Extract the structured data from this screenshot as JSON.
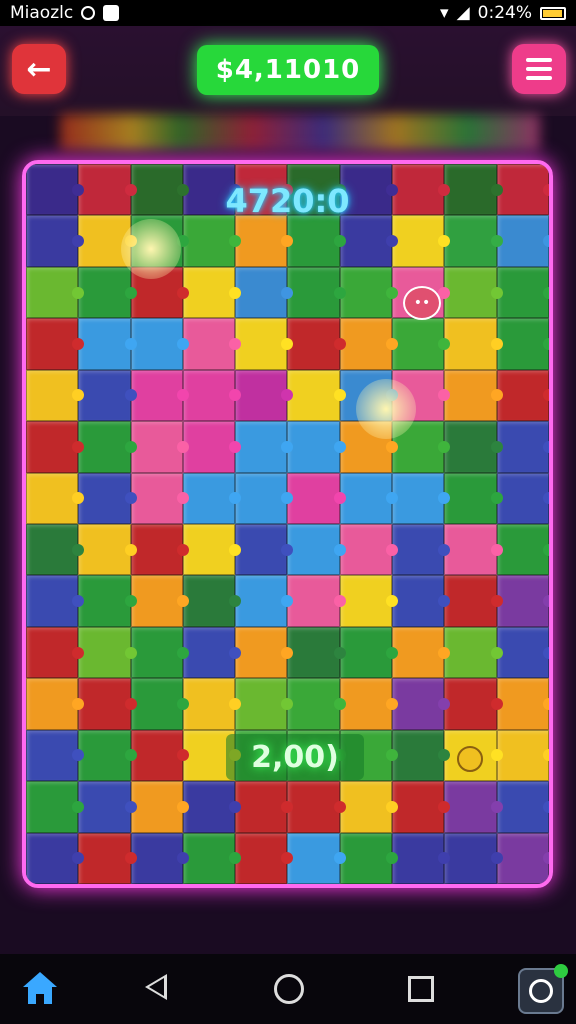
{
  "status_bar": {
    "app_name": "Miaozlc",
    "time": "0:24%"
  },
  "header": {
    "back_icon": "back-arrow-icon",
    "money": "$4,11010",
    "menu_icon": "hamburger-menu-icon"
  },
  "board": {
    "top_score": "4720:0",
    "bonus_score": "2,00)",
    "tile_colors": [
      "#3a2a8a",
      "#c0283a",
      "#2a6a2a",
      "#3a2a8a",
      "#c0283a",
      "#2a6a2a",
      "#3a2a8a",
      "#c0283a",
      "#2a6a2a",
      "#c0283a",
      "#3a3aa0",
      "#f0c020",
      "#2a9a3a",
      "#3aa838",
      "#f09a20",
      "#2a9a3a",
      "#3a3aa0",
      "#f0d020",
      "#30a040",
      "#3a8ad0",
      "#6ab830",
      "#2a9a3a",
      "#c0282a",
      "#f0d020",
      "#3a8ad0",
      "#2a9a3a",
      "#3aa838",
      "#e85a9a",
      "#6ab830",
      "#2a9a3a",
      "#c0282a",
      "#3a9ae0",
      "#3a9ae0",
      "#e85a9a",
      "#f0d020",
      "#c0282a",
      "#f09a20",
      "#3aa838",
      "#f0c020",
      "#2a9a3a",
      "#f0c020",
      "#3a4ab0",
      "#e040a0",
      "#e040a0",
      "#c030a0",
      "#f0d020",
      "#3a8ad0",
      "#e85a9a",
      "#f09a20",
      "#c0282a",
      "#c0282a",
      "#2a9a3a",
      "#e85a9a",
      "#e040a0",
      "#3a9ae0",
      "#3a9ae0",
      "#f09a20",
      "#3aa838",
      "#2a7a3a",
      "#3a4ab0",
      "#f0c020",
      "#3a4ab0",
      "#e85a9a",
      "#3a9ae0",
      "#3a9ae0",
      "#e040a0",
      "#3a9ae0",
      "#3a9ae0",
      "#2a9a3a",
      "#3a4ab0",
      "#2a7a3a",
      "#f0c020",
      "#c0282a",
      "#f0d020",
      "#3a4ab0",
      "#3a9ae0",
      "#e85a9a",
      "#3a4ab0",
      "#e85a9a",
      "#2a9a3a",
      "#3a4ab0",
      "#2a9a3a",
      "#f09a20",
      "#2a7a3a",
      "#3a9ae0",
      "#e85a9a",
      "#f0d020",
      "#3a4ab0",
      "#c0282a",
      "#7a3aa0",
      "#c0282a",
      "#6ab830",
      "#2a9a3a",
      "#3a4ab0",
      "#f09a20",
      "#2a7a3a",
      "#2a9a3a",
      "#f09a20",
      "#6ab830",
      "#3a4ab0",
      "#f09a20",
      "#c0282a",
      "#2a9a3a",
      "#f0c020",
      "#6ab830",
      "#3aa838",
      "#f09a20",
      "#7a3aa0",
      "#c0282a",
      "#f09a20",
      "#3a4ab0",
      "#2a9a3a",
      "#c0282a",
      "#f0d020",
      "#3aa838",
      "#3aa838",
      "#3aa838",
      "#2a7a3a",
      "#f0d020",
      "#f0c020",
      "#2a9a3a",
      "#3a4ab0",
      "#f09a20",
      "#3a3aa0",
      "#c0282a",
      "#c0282a",
      "#f0c020",
      "#c0282a",
      "#7a3aa0",
      "#3a4ab0",
      "#3a3aa0",
      "#c0282a",
      "#3a3aa0",
      "#2a9a3a",
      "#c0282a",
      "#3a9ae0",
      "#2a9a3a",
      "#3a3aa0",
      "#3a3aa0",
      "#7a3aa0"
    ]
  },
  "nav_bar": {
    "home_icon": "home-icon",
    "back_icon": "back-triangle-icon",
    "recents_circle": "home-circle-icon",
    "overview_icon": "square-icon",
    "app_icon": "app-shortcut-icon"
  }
}
